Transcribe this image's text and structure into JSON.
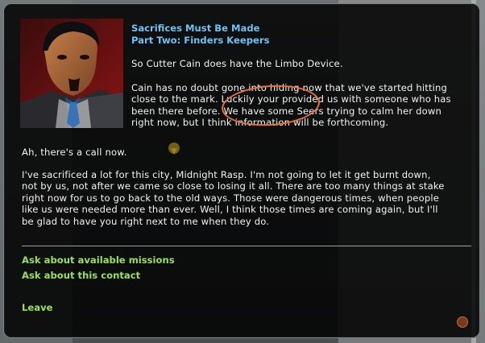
{
  "mission": {
    "title": "Sacrifices Must Be Made",
    "subtitle": "Part Two: Finders Keepers"
  },
  "dialog": {
    "paragraphs": [
      "So Cutter Cain does have the Limbo Device.",
      "Cain has no doubt gone into hiding now that we've started hitting\nclose to the mark. Luckily your provided us with someone who has\nbeen there before. We have some Seers trying to calm her down\nright now, but I think information will be forthcoming.",
      "Ah, there's a call now.",
      "I've sacrificed a lot for this city, Midnight Rasp. I'm not going to let it get burnt down,\nnot by us, not after we came so close to losing it all. There are too many things at stake\nright now for us to go back to the old ways. Those were dangerous times, when people\nlike us were needed more than ever. Well, I think those times are coming again, but I'll\nbe glad to have you right next to me when they do."
    ]
  },
  "options": {
    "missions": "Ask about available missions",
    "contact": "Ask about this contact",
    "leave": "Leave"
  },
  "colors": {
    "title": "#6ec3f2",
    "option": "#9be15a",
    "annotation": "#e8703a"
  }
}
